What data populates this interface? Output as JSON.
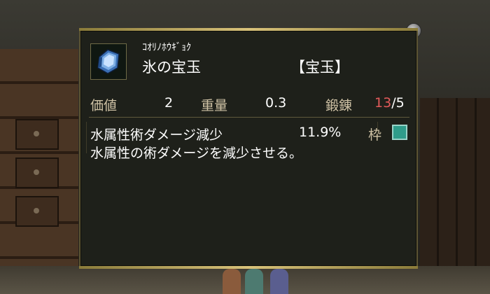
{
  "item": {
    "reading": "ｺｵﾘﾉﾎｳｷﾞｮｸ",
    "name": "氷の宝玉",
    "category": "【宝玉】",
    "icon": "blue-gem-icon"
  },
  "stats": {
    "value_label": "価値",
    "value": "2",
    "weight_label": "重量",
    "weight": "0.3",
    "forge_label": "鍛錬",
    "forge_current": "13",
    "forge_max": "/5"
  },
  "effect": {
    "name": "水属性術ダメージ減少",
    "value": "11.9%",
    "slot_label": "枠",
    "slot_color": "#2f9c8a",
    "description": "水属性の術ダメージを減少させる。"
  },
  "colors": {
    "panel_bg": "#1e201a",
    "label": "#cfc2a5",
    "forge_highlight": "#e25a5a",
    "gold_trim": "#d8c27a"
  }
}
